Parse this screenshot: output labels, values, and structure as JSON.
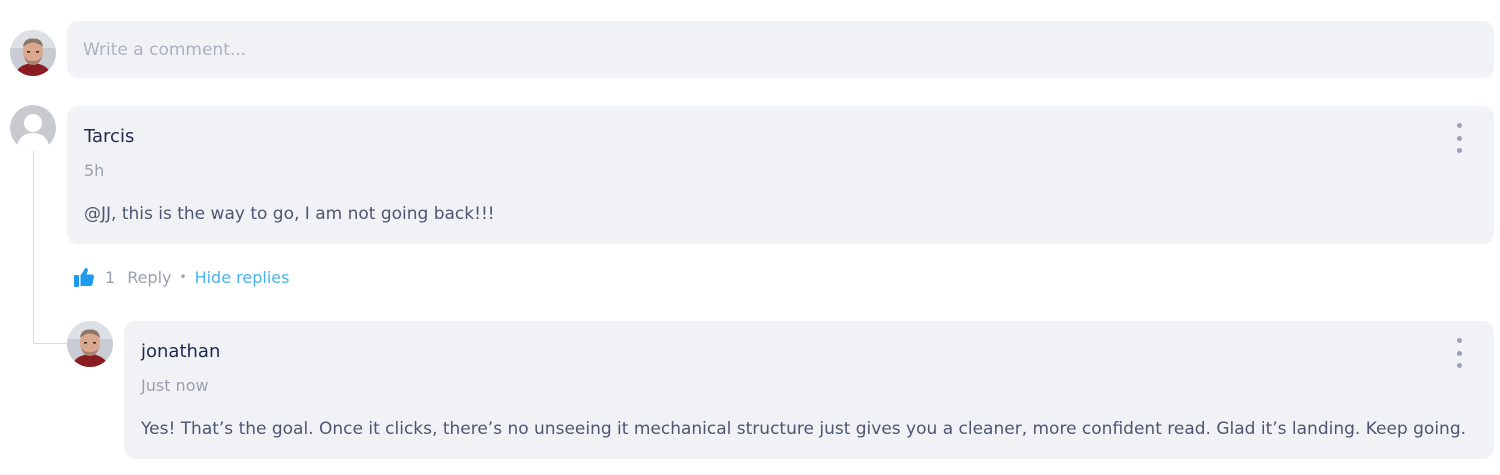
{
  "composer": {
    "placeholder": "Write a comment..."
  },
  "comment": {
    "author": "Tarcis",
    "time": "5h",
    "text": "@JJ, this is the way to go, I am not going back!!!",
    "like_count": "1",
    "reply_label": "Reply",
    "separator": "•",
    "hide_replies_label": "Hide replies"
  },
  "reply": {
    "author": "jonathan",
    "time": "Just now",
    "text": "Yes! That’s the goal. Once it clicks, there’s no unseeing it mechanical structure just gives you a cleaner, more confident read. Glad it’s landing. Keep going."
  },
  "icons": {
    "user_avatar": "user-photo-avatar",
    "placeholder_avatar": "default-user-avatar-icon",
    "like": "thumbs-up-icon",
    "more": "more-vertical-icon"
  },
  "colors": {
    "bubble_bg": "#f1f2f6",
    "accent": "#4ab3ea",
    "like_icon": "#1e9af0"
  }
}
